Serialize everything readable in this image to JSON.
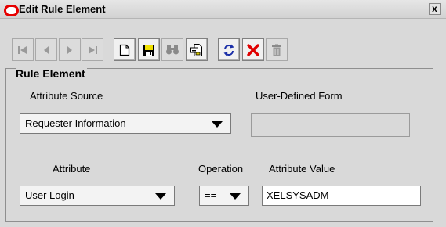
{
  "window": {
    "title": "Edit Rule Element",
    "close_label": "x",
    "accent": "#e60000"
  },
  "toolbar": {
    "buttons": [
      {
        "name": "first-record",
        "icon": "first-icon",
        "enabled": false
      },
      {
        "name": "previous-record",
        "icon": "previous-icon",
        "enabled": false
      },
      {
        "name": "next-record",
        "icon": "next-icon",
        "enabled": false
      },
      {
        "name": "last-record",
        "icon": "last-icon",
        "enabled": false
      },
      {
        "name": "new",
        "icon": "new-document-icon",
        "enabled": true
      },
      {
        "name": "save",
        "icon": "save-icon",
        "enabled": true
      },
      {
        "name": "find",
        "icon": "binoculars-icon",
        "enabled": false
      },
      {
        "name": "query",
        "icon": "query-icon",
        "enabled": true
      },
      {
        "name": "refresh",
        "icon": "refresh-icon",
        "enabled": true
      },
      {
        "name": "delete",
        "icon": "delete-x-icon",
        "enabled": true
      },
      {
        "name": "trash",
        "icon": "trash-icon",
        "enabled": false
      }
    ]
  },
  "rule_element": {
    "group_title": "Rule Element",
    "attribute_source_label": "Attribute Source",
    "attribute_source_value": "Requester Information",
    "user_defined_form_label": "User-Defined Form",
    "user_defined_form_value": "",
    "attribute_label": "Attribute",
    "attribute_value_selected": "User Login",
    "operation_label": "Operation",
    "operation_value": "==",
    "attribute_value_label": "Attribute Value",
    "attribute_value_text": "XELSYSADM"
  }
}
